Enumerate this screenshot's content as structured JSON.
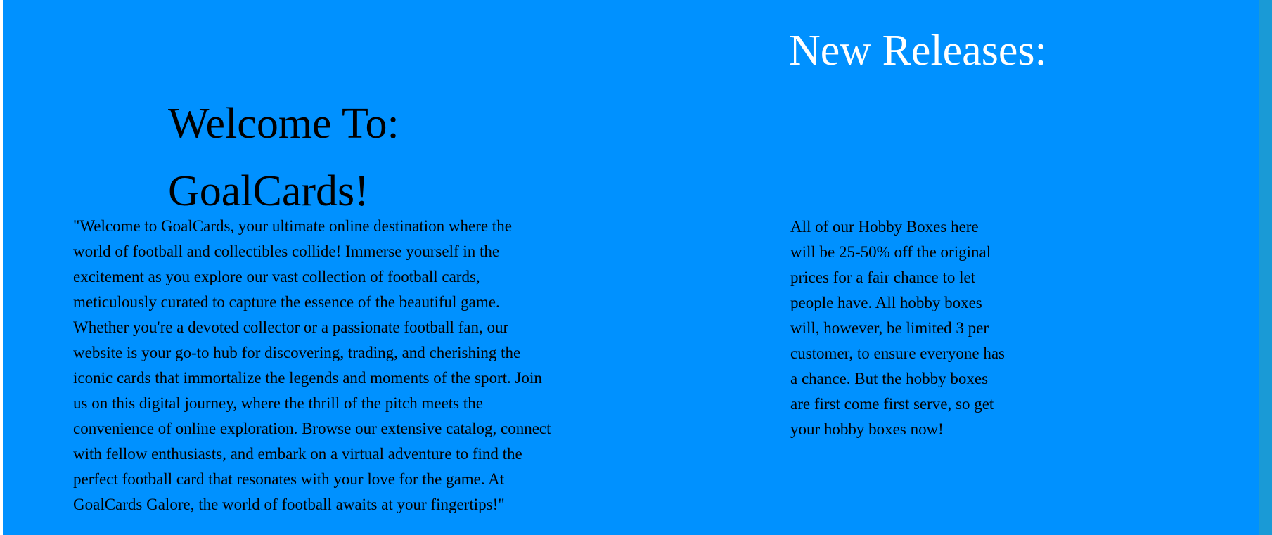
{
  "welcome": {
    "line1": "Welcome To:",
    "line2": "GoalCards!"
  },
  "intro": {
    "text": "\"Welcome to GoalCards, your ultimate online destination where the world of football and collectibles collide! Immerse yourself in the excitement as you explore our vast collection of football cards, meticulously curated to capture the essence of the beautiful game. Whether you're a devoted collector or a passionate football fan, our website is your go-to hub for discovering, trading, and cherishing the iconic cards that immortalize the legends and moments of the sport. Join us on this digital journey, where the thrill of the pitch meets the convenience of online exploration. Browse our extensive catalog, connect with fellow enthusiasts, and embark on a virtual adventure to find the perfect football card that resonates with your love for the game. At GoalCards Galore, the world of football awaits at your fingertips!\""
  },
  "releases": {
    "title": "New Releases:",
    "text": "All of our Hobby Boxes here will be 25-50% off the original prices for a fair chance to let people have. All hobby boxes will, however, be limited 3 per customer, to ensure everyone has a chance. But the hobby boxes are first come first serve, so get your hobby boxes now!"
  },
  "colors": {
    "background": "#0091ff",
    "right_strip": "#1a9ad6",
    "body_text": "#000000",
    "releases_title": "#ffffff"
  }
}
